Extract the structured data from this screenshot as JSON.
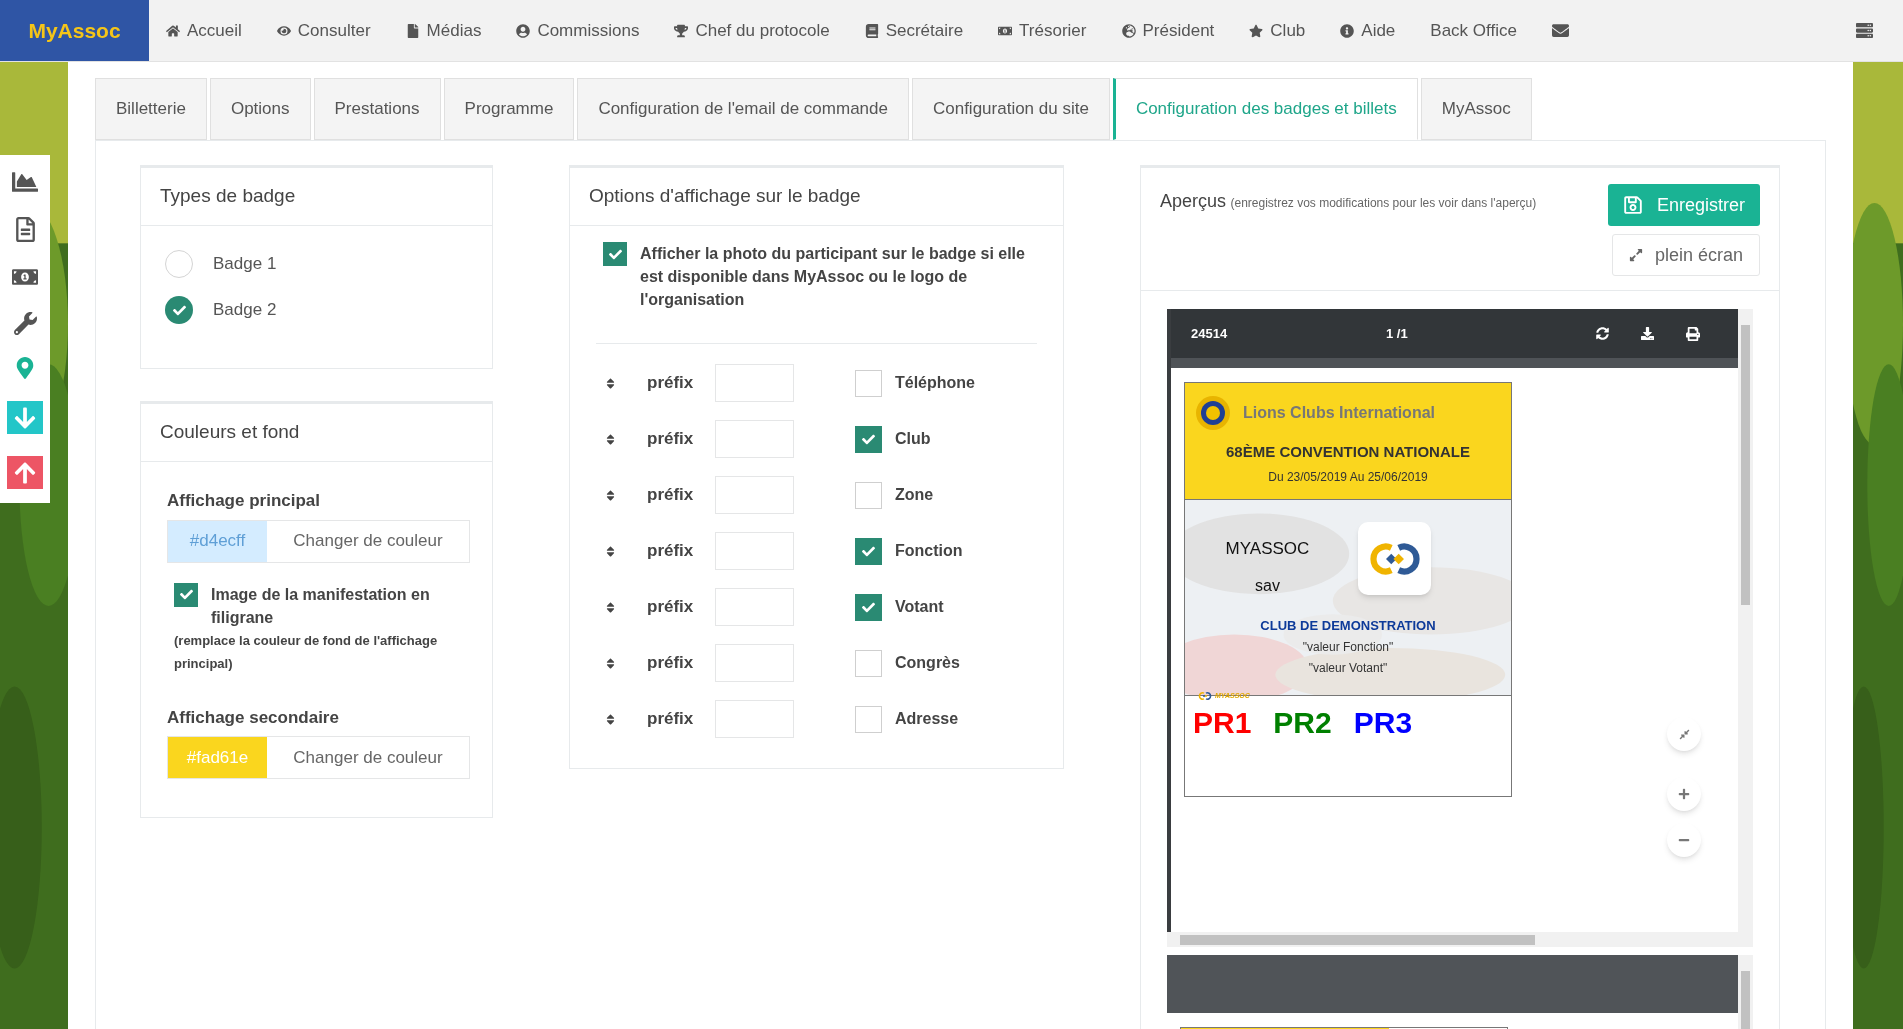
{
  "nav": {
    "brand": "MyAssoc",
    "items": [
      {
        "label": "Accueil"
      },
      {
        "label": "Consulter"
      },
      {
        "label": "Médias"
      },
      {
        "label": "Commissions"
      },
      {
        "label": "Chef du protocole"
      },
      {
        "label": "Secrétaire"
      },
      {
        "label": "Trésorier"
      },
      {
        "label": "Président"
      },
      {
        "label": "Club"
      },
      {
        "label": "Aide"
      }
    ],
    "back_office": "Back Office"
  },
  "tabs": [
    {
      "label": "Billetterie",
      "selected": false
    },
    {
      "label": "Options",
      "selected": false
    },
    {
      "label": "Prestations",
      "selected": false
    },
    {
      "label": "Programme",
      "selected": false
    },
    {
      "label": "Configuration de l'email de commande",
      "selected": false
    },
    {
      "label": "Configuration du site",
      "selected": false
    },
    {
      "label": "Configuration des badges et billets",
      "selected": true
    },
    {
      "label": "MyAssoc",
      "selected": false
    }
  ],
  "badge_types": {
    "title": "Types de badge",
    "options": [
      {
        "label": "Badge 1",
        "selected": false
      },
      {
        "label": "Badge 2",
        "selected": true
      }
    ]
  },
  "colors": {
    "title": "Couleurs et fond",
    "primary": {
      "label": "Affichage principal",
      "value": "#d4ecff",
      "color": "#d4ecff",
      "button": "Changer de couleur"
    },
    "watermark": {
      "label": "Image de la manifestation en filigrane",
      "note": "(remplace la couleur de fond de l'affichage principal)",
      "checked": true
    },
    "secondary": {
      "label": "Affichage secondaire",
      "value": "#fad61e",
      "color": "#fad61e",
      "button": "Changer de couleur"
    }
  },
  "display_options": {
    "title": "Options d'affichage sur le badge",
    "photo": {
      "label": "Afficher la photo du participant sur le badge si elle est disponible dans MyAssoc ou le logo de l'organisation",
      "checked": true
    },
    "rows": [
      {
        "prefix": "préfix",
        "field": "Téléphone",
        "checked": false
      },
      {
        "prefix": "préfix",
        "field": "Club",
        "checked": true
      },
      {
        "prefix": "préfix",
        "field": "Zone",
        "checked": false
      },
      {
        "prefix": "préfix",
        "field": "Fonction",
        "checked": true
      },
      {
        "prefix": "préfix",
        "field": "Votant",
        "checked": true
      },
      {
        "prefix": "préfix",
        "field": "Congrès",
        "checked": false
      },
      {
        "prefix": "préfix",
        "field": "Adresse",
        "checked": false
      }
    ]
  },
  "preview": {
    "title": "Aperçus",
    "note": "(enregistrez vos modifications pour les voir dans l'aperçu)",
    "save_button": "Enregistrer",
    "fullscreen_button": "plein écran",
    "viewer": {
      "doc_name": "24514",
      "page": "1 /1"
    },
    "badge": {
      "org": "Lions Clubs International",
      "event": "68ÈME CONVENTION NATIONALE",
      "dates": "Du 23/05/2019 Au 25/06/2019",
      "name": "MYASSOC",
      "first_name": "sav",
      "club": "CLUB DE DEMONSTRATION",
      "fields": [
        "\"valeur Fonction\"",
        "\"valeur Votant\""
      ],
      "footer_logo": "MYASSOC",
      "codes": [
        {
          "text": "PR1",
          "color": "#ff0000"
        },
        {
          "text": "PR2",
          "color": "#008000"
        },
        {
          "text": "PR3",
          "color": "#0000ff"
        }
      ]
    }
  }
}
